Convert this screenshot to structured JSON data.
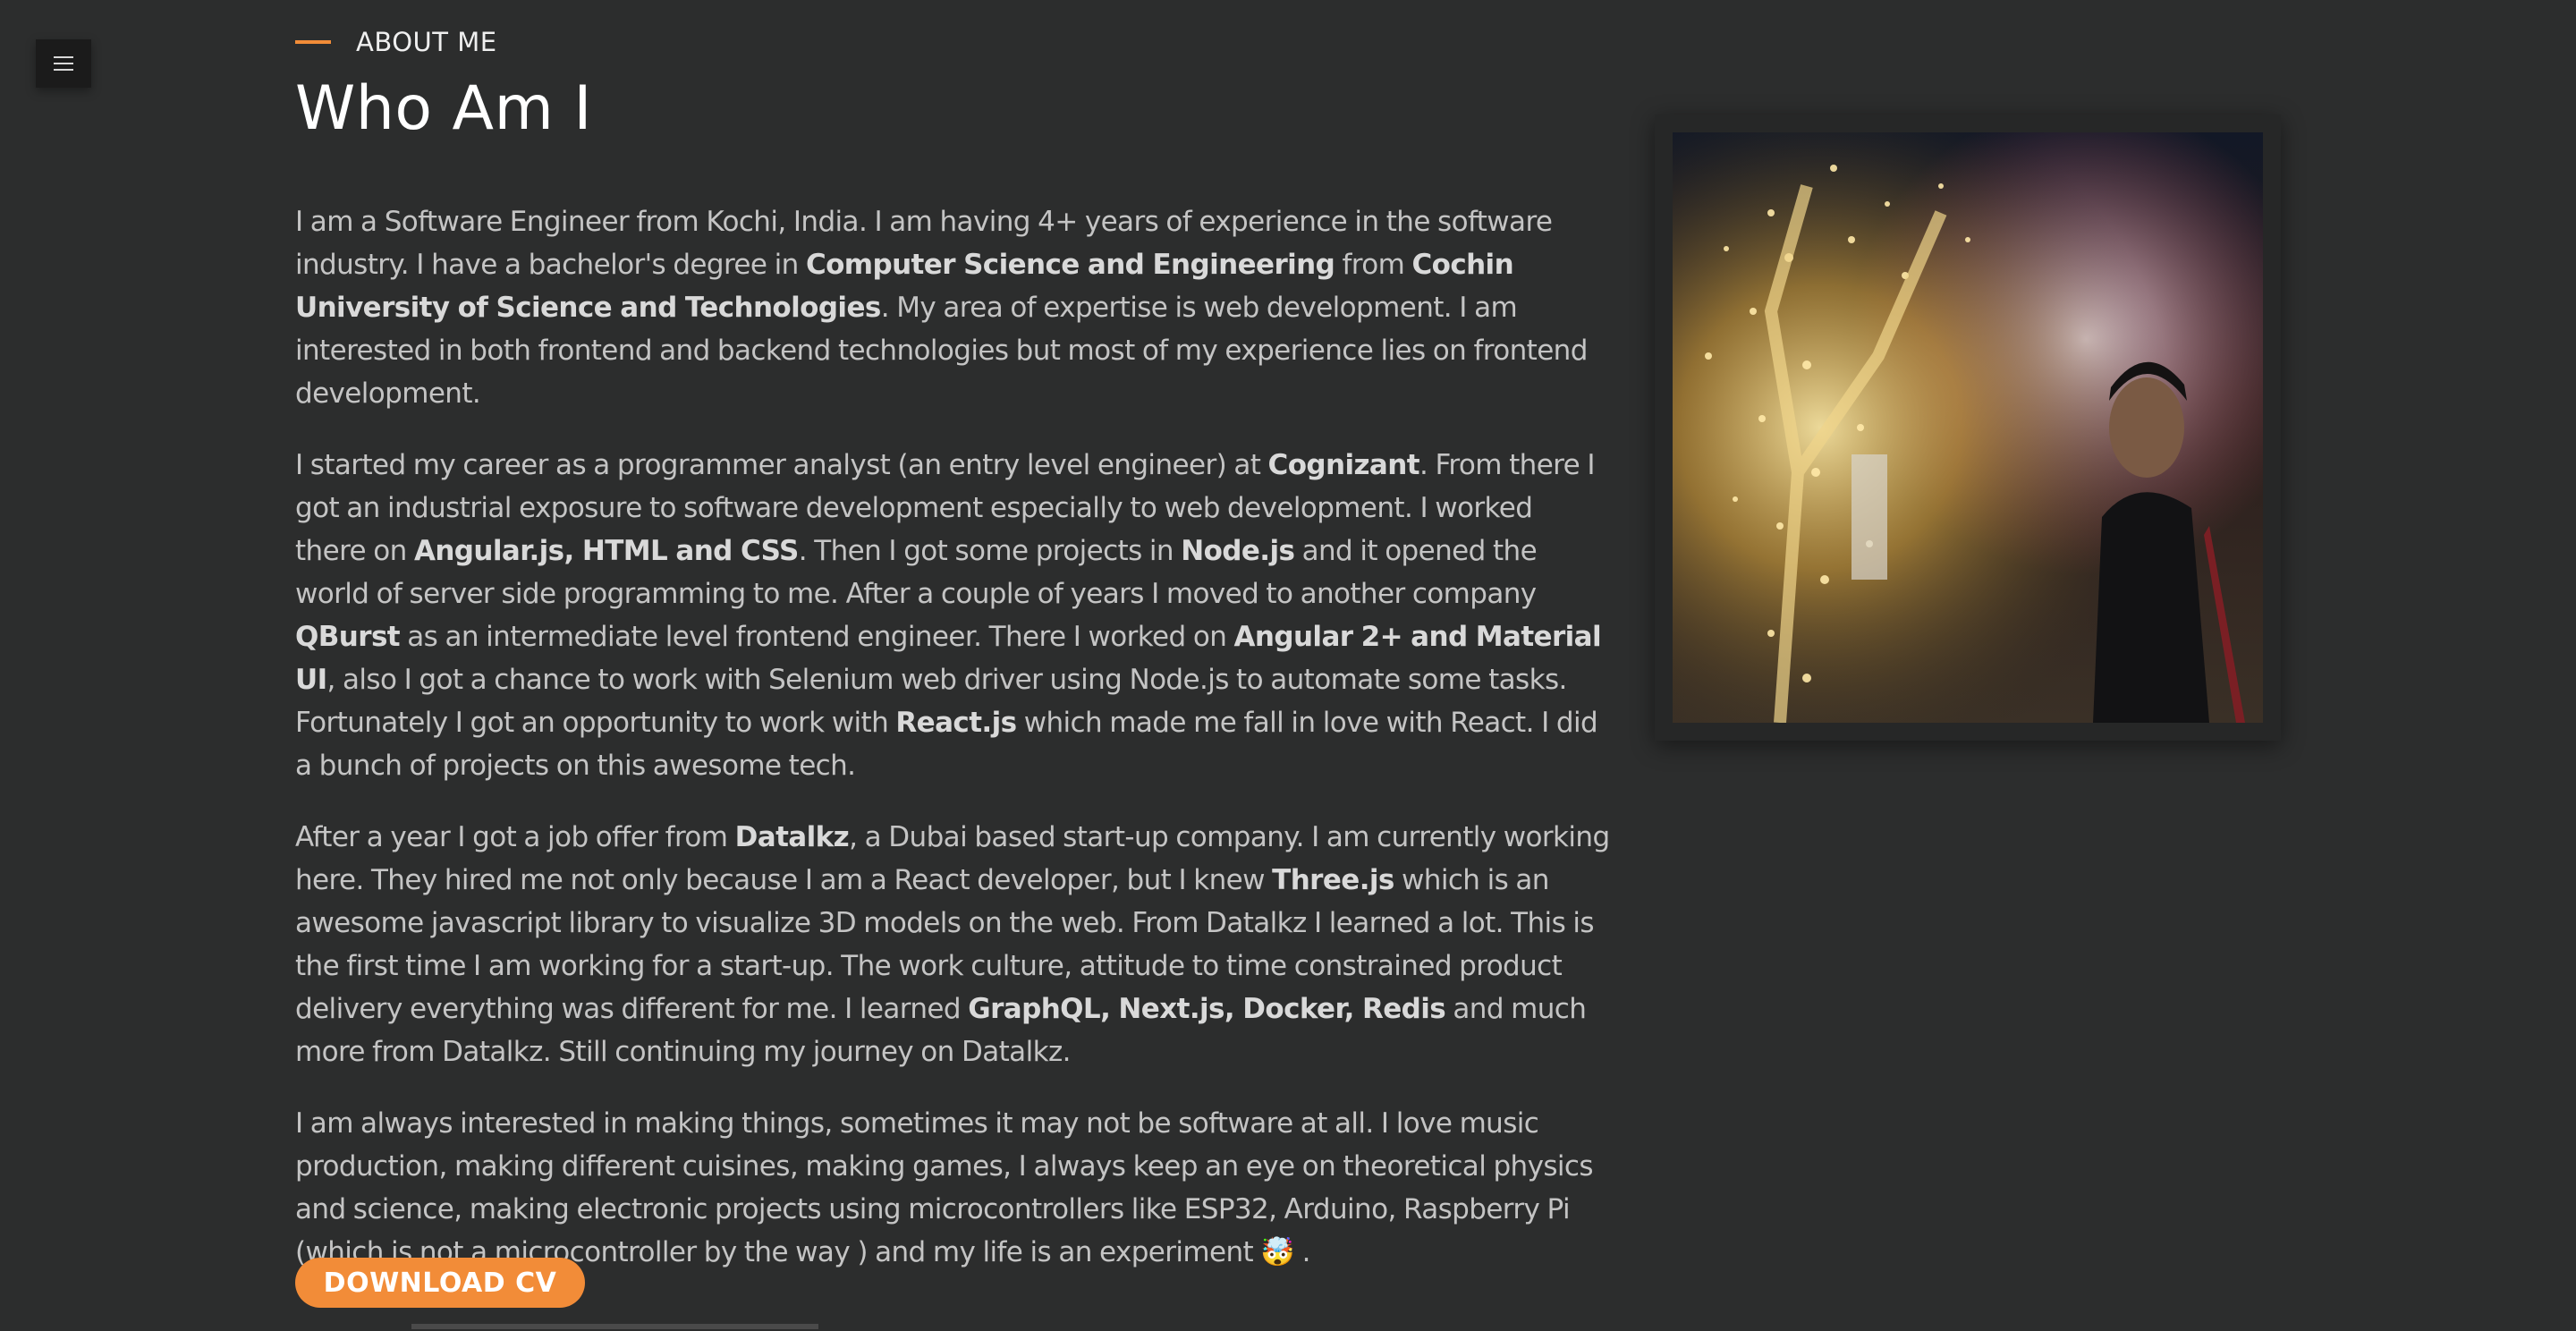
{
  "header": {
    "eyebrow": "ABOUT ME",
    "title": "Who Am I"
  },
  "nav": {
    "menu_icon": "hamburger-menu-icon"
  },
  "bio": {
    "p1": [
      "I am a Software Engineer from Kochi, India. I am having 4+ years of experience in the software industry. I have a bachelor's degree in ",
      "Computer Science and Engineering",
      " from ",
      "Cochin University of Science and Technologies",
      ". My area of expertise is web development. I am interested in both frontend and backend technologies but most of my experience lies on frontend development."
    ],
    "p2": [
      "I started my career as a programmer analyst (an entry level engineer) at ",
      "Cognizant",
      ". From there I got an industrial exposure to software development especially to web development. I worked there on ",
      "Angular.js, HTML and CSS",
      ". Then I got some projects in ",
      "Node.js",
      " and it opened the world of server side programming to me. After a couple of years I moved to another company ",
      "QBurst",
      " as an intermediate level frontend engineer. There I worked on ",
      "Angular 2+ and Material UI",
      ", also I got a chance to work with Selenium web driver using Node.js to automate some tasks. Fortunately I got an opportunity to work with ",
      "React.js",
      " which made me fall in love with React. I did a bunch of projects on this awesome tech."
    ],
    "p3": [
      "After a year I got a job offer from ",
      "Datalkz",
      ", a Dubai based start-up company. I am currently working here. They hired me not only because I am a React developer, but I knew ",
      "Three.js",
      " which is an awesome javascript library to visualize 3D models on the web. From Datalkz I learned a lot. This is the first time I am working for a start-up. The work culture, attitude to time constrained product delivery everything was different for me. I learned ",
      "GraphQL, Next.js, Docker, Redis",
      " and much more from Datalkz. Still continuing my journey on Datalkz."
    ],
    "p4": [
      "I am always interested in making things, sometimes it may not be software at all. I love music production, making different cuisines, making games, I always keep an eye on theoretical physics and science, making electronic projects using microcontrollers like ESP32, Arduino, Raspberry Pi (which is not a microcontroller by the way ) and my life is an experiment ",
      "🤯",
      " ."
    ]
  },
  "actions": {
    "download_cv": "DOWNLOAD CV"
  },
  "colors": {
    "background": "#2c2d2d",
    "accent": "#f28c38",
    "text": "#c4c4c4",
    "heading": "#ffffff"
  }
}
